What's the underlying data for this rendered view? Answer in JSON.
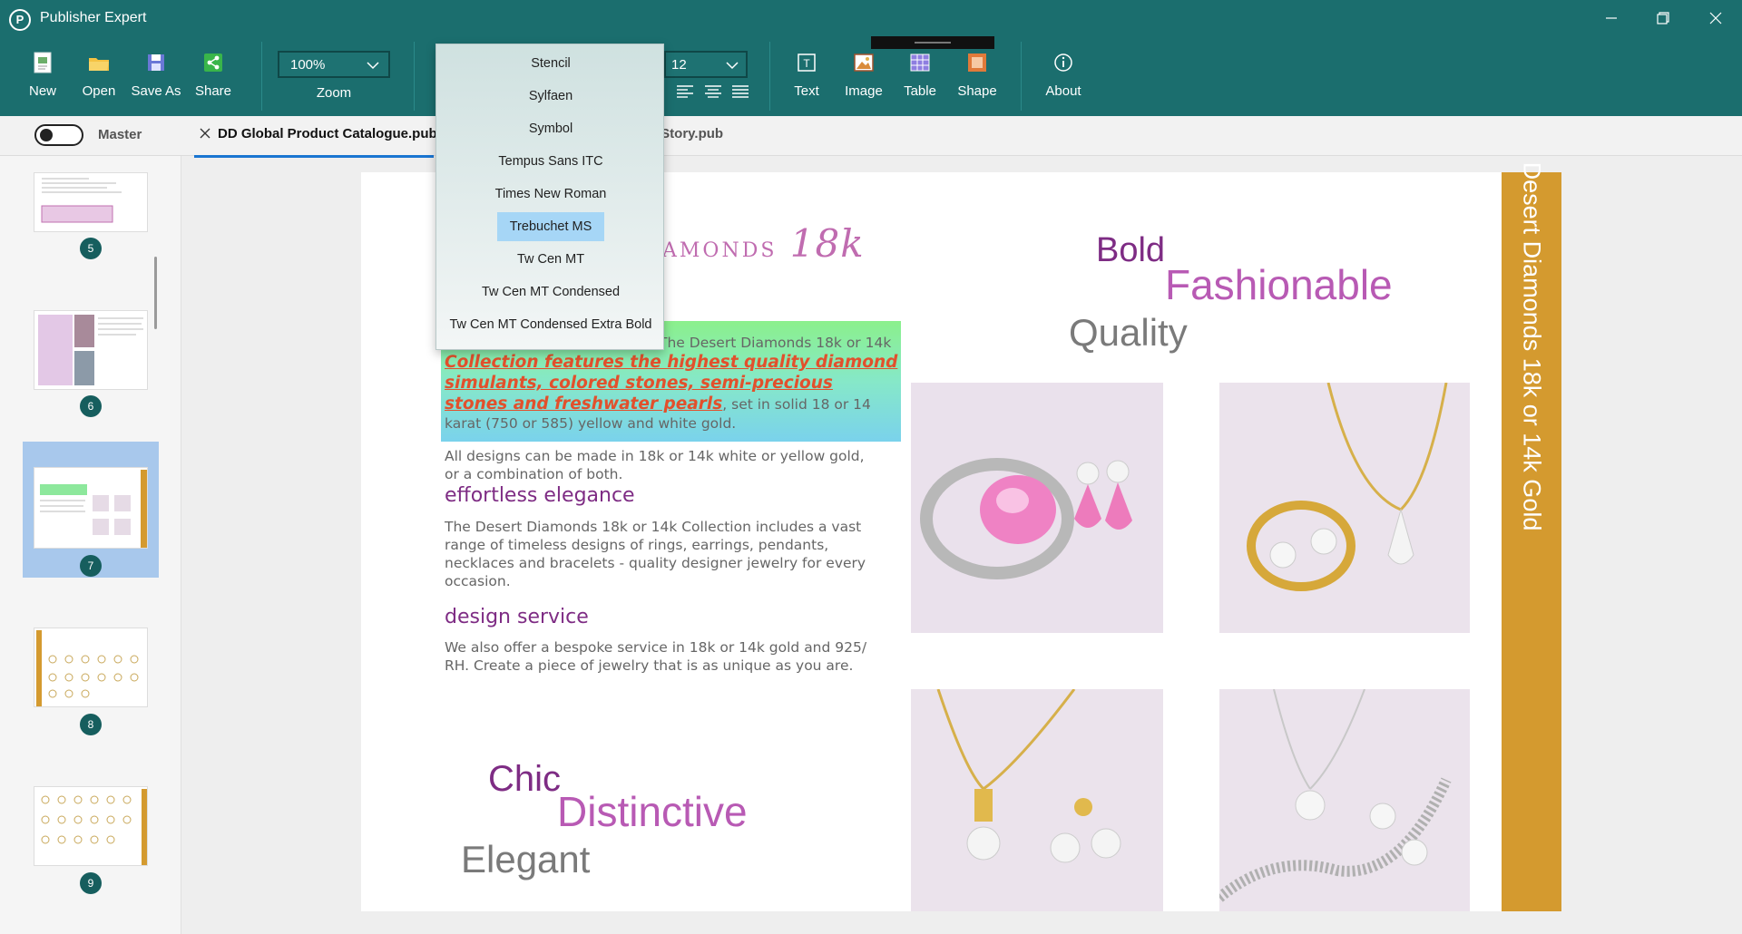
{
  "app": {
    "title": "Publisher Expert",
    "logo_letter": "P"
  },
  "ribbon": {
    "new": "New",
    "open": "Open",
    "save_as": "Save As",
    "share": "Share",
    "zoom_value": "100%",
    "zoom_label": "Zoom",
    "font_size": "12",
    "text": "Text",
    "image": "Image",
    "table": "Table",
    "shape": "Shape",
    "about": "About"
  },
  "subbar": {
    "master_label": "Master",
    "tab_active": "DD Global Product Catalogue.pub",
    "tab_second": "side Story.pub"
  },
  "thumbnails": {
    "pages": [
      "5",
      "6",
      "7",
      "8",
      "9"
    ],
    "selected": "7"
  },
  "font_dropdown": {
    "items": [
      "Stencil",
      "Sylfaen",
      "Symbol",
      "Tempus Sans ITC",
      "Times New Roman",
      "Trebuchet MS",
      "Tw Cen MT",
      "Tw Cen MT Condensed",
      "Tw Cen MT Condensed Extra Bold"
    ],
    "selected": "Trebuchet MS"
  },
  "document": {
    "heading_fragment_small": "AMONDS",
    "heading_fragment_big": "18k",
    "side_band": "Desert Diamonds 18k or 14k Gold",
    "words_top": {
      "bold": "Bold",
      "fashionable": "Fashionable",
      "quality": "Quality"
    },
    "words_bottom": {
      "chic": "Chic",
      "distinctive": "Distinctive",
      "elegant": "Elegant"
    },
    "hl_intro": "The Desert Diamonds 18k or 14k",
    "hl_collection": "Collection features the highest quality diamond simulants, colored stones, semi-precious stones and freshwater pearls",
    "hl_tail": ", set in solid 18 or 14 karat (750 or 585) yellow and white gold.",
    "para_designs": "All designs can be made in 18k or 14k white or yellow gold, or a combination of both.",
    "heading_effortless": "effortless elegance",
    "para_range": "The Desert Diamonds 18k or 14k Collection includes a vast range of timeless designs of rings, earrings, pendants, necklaces and bracelets - quality designer jewelry for every occasion.",
    "heading_design": "design service",
    "para_bespoke": "We also offer a bespoke service in 18k or 14k gold and 925/ RH.  Create a piece of jewelry that is as unique as you are."
  },
  "colors": {
    "ribbon": "#1b6e6e",
    "accent_gold": "#d49a2f",
    "purple": "#7e2c84",
    "pink": "#b85ab4",
    "highlight": "#e2502c"
  }
}
